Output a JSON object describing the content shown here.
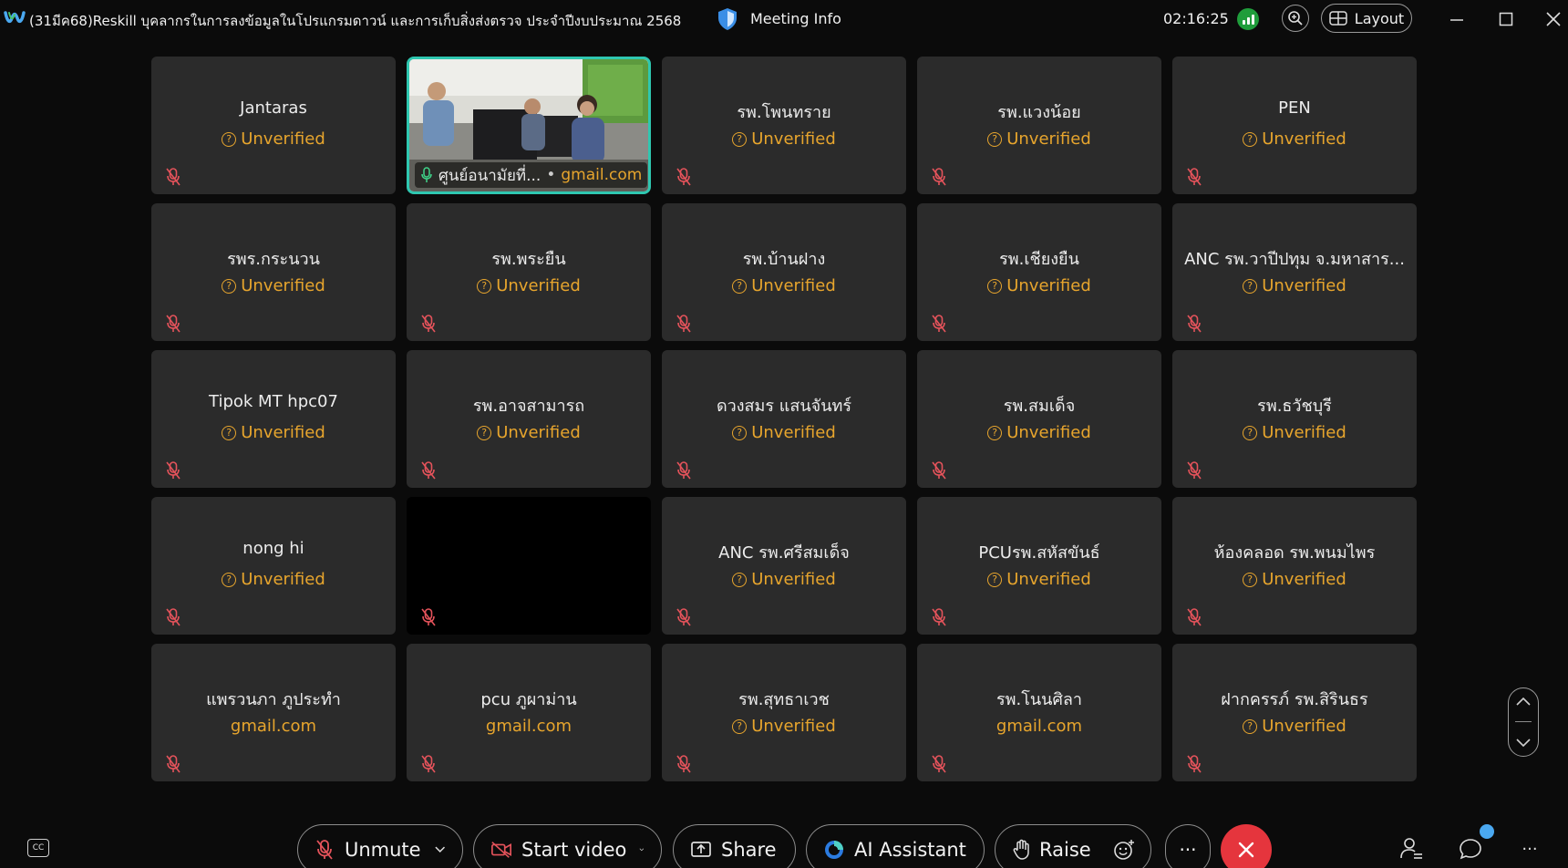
{
  "titlebar": {
    "title": "(31มีค68)Reskill บุคลากรในการลงข้อมูลในโปรแกรมดาวน์ และการเก็บสิ่งส่งตรวจ ประจำปีงบประมาณ 2568",
    "meeting_info": "Meeting Info",
    "timer": "02:16:25",
    "layout_label": "Layout"
  },
  "colors": {
    "unverified": "#e7a52d",
    "active_border": "#2fc7b0",
    "leave": "#e5353d",
    "signal": "#1f9d3b"
  },
  "participants": [
    {
      "name": "Jantaras",
      "status": "Unverified",
      "status_icon": "question-circle-icon"
    },
    {
      "name": "ศูนย์อนามัยที่...",
      "status": "gmail.com",
      "video": true
    },
    {
      "name": "รพ.โพนทราย",
      "status": "Unverified",
      "status_icon": "question-circle-icon"
    },
    {
      "name": "รพ.แวงน้อย",
      "status": "Unverified",
      "status_icon": "question-circle-icon"
    },
    {
      "name": "PEN",
      "status": "Unverified",
      "status_icon": "question-circle-icon"
    },
    {
      "name": "รพร.กระนวน",
      "status": "Unverified",
      "status_icon": "question-circle-icon"
    },
    {
      "name": "รพ.พระยืน",
      "status": "Unverified",
      "status_icon": "question-circle-icon"
    },
    {
      "name": "รพ.บ้านฝาง",
      "status": "Unverified",
      "status_icon": "question-circle-icon"
    },
    {
      "name": "รพ.เชียงยืน",
      "status": "Unverified",
      "status_icon": "question-circle-icon"
    },
    {
      "name": "ANC รพ.วาปีปทุม จ.มหาสาร...",
      "status": "Unverified",
      "status_icon": "question-circle-icon"
    },
    {
      "name": "Tipok MT hpc07",
      "status": "Unverified",
      "status_icon": "question-circle-icon"
    },
    {
      "name": "รพ.อาจสามารถ",
      "status": "Unverified",
      "status_icon": "question-circle-icon"
    },
    {
      "name": "ดวงสมร  แสนจันทร์",
      "status": "Unverified",
      "status_icon": "question-circle-icon"
    },
    {
      "name": "รพ.สมเด็จ",
      "status": "Unverified",
      "status_icon": "question-circle-icon"
    },
    {
      "name": "รพ.ธวัชบุรี",
      "status": "Unverified",
      "status_icon": "question-circle-icon"
    },
    {
      "name": "nong hi",
      "status": "Unverified",
      "status_icon": "question-circle-icon"
    },
    {
      "name": "",
      "status": "",
      "black": true
    },
    {
      "name": "ANC รพ.ศรีสมเด็จ",
      "status": "Unverified",
      "status_icon": "question-circle-icon"
    },
    {
      "name": "PCUรพ.สหัสขันธ์",
      "status": "Unverified",
      "status_icon": "question-circle-icon"
    },
    {
      "name": "ห้องคลอด รพ.พนมไพร",
      "status": "Unverified",
      "status_icon": "question-circle-icon"
    },
    {
      "name": "แพรวนภา ภูประทำ",
      "status": "gmail.com"
    },
    {
      "name": "pcu ภูผาม่าน",
      "status": "gmail.com"
    },
    {
      "name": "รพ.สุทธาเวช",
      "status": "Unverified",
      "status_icon": "question-circle-icon"
    },
    {
      "name": "รพ.โนนศิลา",
      "status": "gmail.com"
    },
    {
      "name": "ฝากครรภ์ รพ.สิรินธร",
      "status": "Unverified",
      "status_icon": "question-circle-icon"
    }
  ],
  "toolbar": {
    "unmute": "Unmute",
    "start_video": "Start video",
    "share": "Share",
    "ai_assistant": "AI Assistant",
    "raise": "Raise",
    "more": "···",
    "overflow": "···",
    "cc": "CC"
  }
}
